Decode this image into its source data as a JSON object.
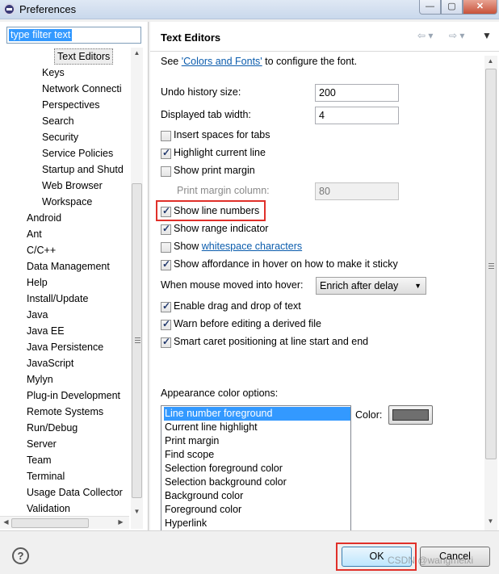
{
  "window": {
    "title": "Preferences",
    "min_label": "—",
    "max_label": "▢",
    "close_label": "✕"
  },
  "filter": {
    "value": "type filter text"
  },
  "tree": {
    "items": [
      "Text Editors",
      "Keys",
      "Network Connecti",
      "Perspectives",
      "Search",
      "Security",
      "Service Policies",
      "Startup and Shutd",
      "Web Browser",
      "Workspace",
      "Android",
      "Ant",
      "C/C++",
      "Data Management",
      "Help",
      "Install/Update",
      "Java",
      "Java EE",
      "Java Persistence",
      "JavaScript",
      "Mylyn",
      "Plug-in Development",
      "Remote Systems",
      "Run/Debug",
      "Server",
      "Team",
      "Terminal",
      "Usage Data Collector",
      "Validation"
    ],
    "selected": "Text Editors"
  },
  "page": {
    "title": "Text Editors",
    "see_prefix": "See ",
    "see_link": "'Colors and Fonts'",
    "see_suffix": " to configure the font.",
    "undo_label": "Undo history size:",
    "undo_value": "200",
    "tab_label": "Displayed tab width:",
    "tab_value": "4",
    "insert_spaces": "Insert spaces for tabs",
    "highlight_line": "Highlight current line",
    "print_margin": "Show print margin",
    "print_margin_col_label": "Print margin column:",
    "print_margin_col_value": "80",
    "line_numbers": "Show line numbers",
    "range_indicator": "Show range indicator",
    "whitespace_prefix": "Show ",
    "whitespace_link": "whitespace characters",
    "affordance": "Show affordance in hover on how to make it sticky",
    "mouse_moved_label": "When mouse moved into hover:",
    "mouse_moved_value": "Enrich after delay",
    "drag_drop": "Enable drag and drop of text",
    "warn_derived": "Warn before editing a derived file",
    "smart_caret": "Smart caret positioning at line start and end",
    "appearance_label": "Appearance color options:",
    "color_options": [
      "Line number foreground",
      "Current line highlight",
      "Print margin",
      "Find scope",
      "Selection foreground color",
      "Selection background color",
      "Background color",
      "Foreground color",
      "Hyperlink"
    ],
    "color_label": "Color:",
    "color_value": "#6f6f6f"
  },
  "buttons": {
    "help": "?",
    "ok": "OK",
    "cancel": "Cancel"
  },
  "watermark": "CSDN @wangmeixi",
  "accent": {
    "selection": "#3399ff",
    "highlight_box": "#e0302a"
  }
}
